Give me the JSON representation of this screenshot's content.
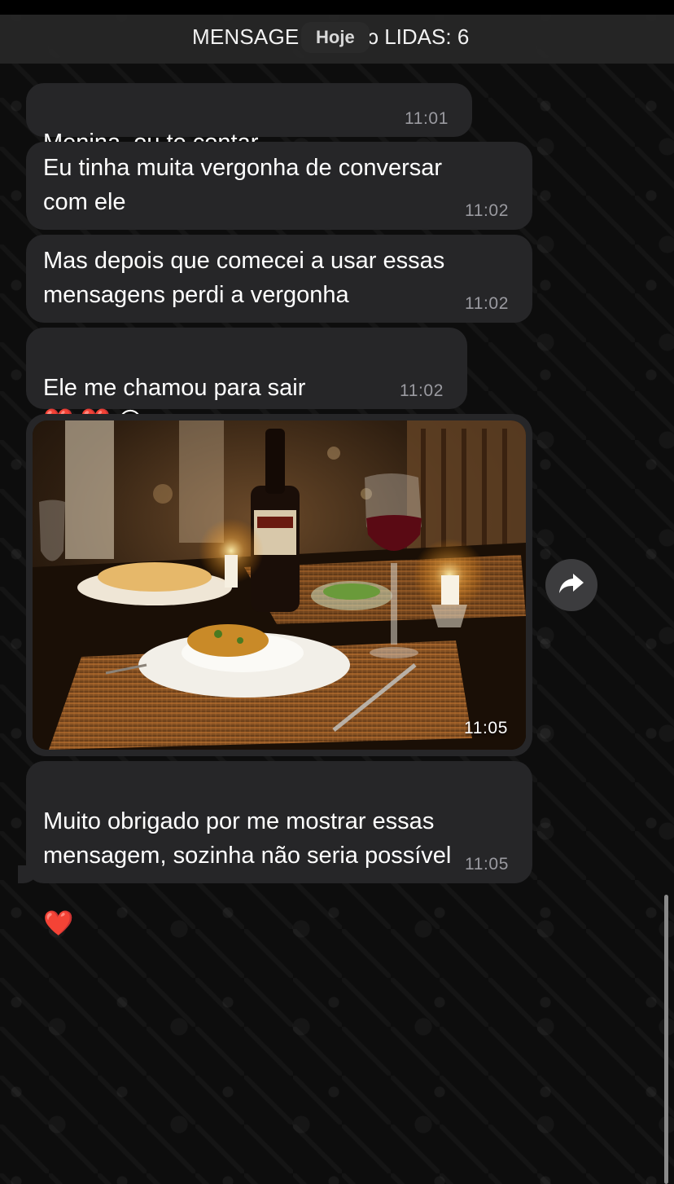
{
  "header": {
    "title_left": "MENSAGE",
    "date_label": "Hoje",
    "title_right": "ɔ LIDAS: 6"
  },
  "messages": [
    {
      "text": "Menina, ou te contar",
      "emoji": "😱 😱",
      "time": "11:01"
    },
    {
      "text": "Eu tinha muita vergonha de conversar\ncom ele",
      "time": "11:02"
    },
    {
      "text": "Mas depois que comecei a usar essas\nmensagens perdi a vergonha",
      "time": "11:02"
    },
    {
      "text": "Ele me chamou para sair",
      "emoji": "❤️ ❤️ 😍",
      "time": "11:02"
    },
    {
      "type": "photo",
      "time": "11:05"
    },
    {
      "text": "Muito obrigado por me mostrar essas\nmensagem, sozinha não seria possível",
      "emoji": "❤️",
      "time": "11:05"
    }
  ],
  "icons": {
    "forward": "forward-arrow-icon"
  },
  "colors": {
    "bubble": "#262628",
    "background": "#0d0d0d",
    "header": "#262626",
    "time_text": "#9a9aa0"
  }
}
